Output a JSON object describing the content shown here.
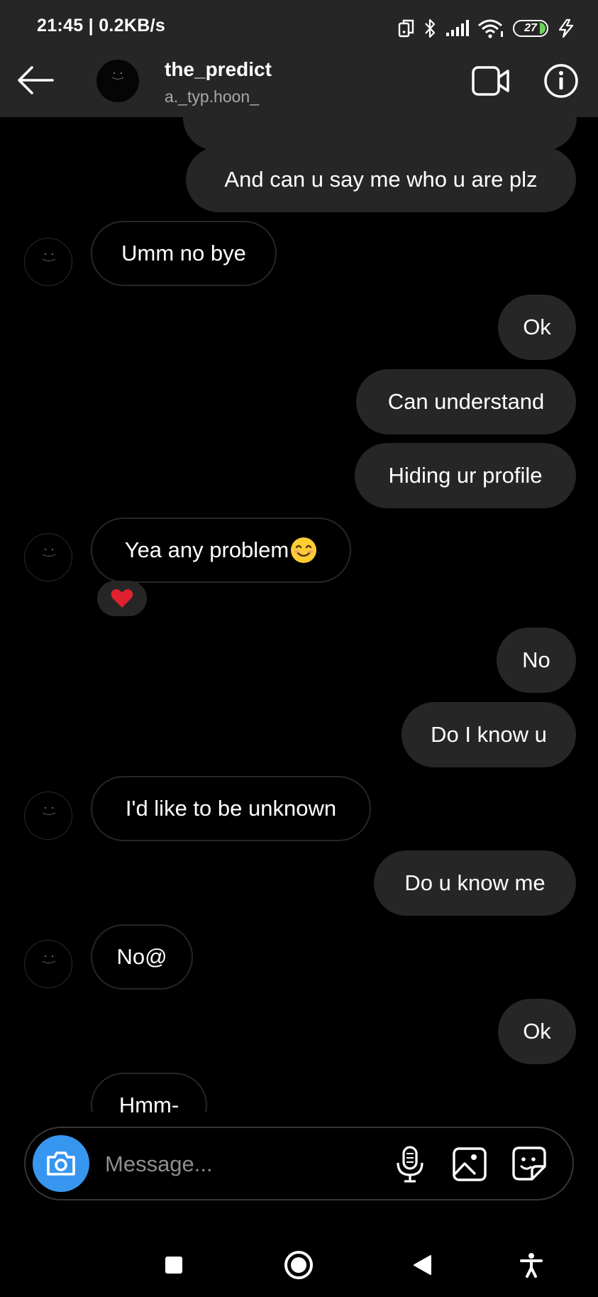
{
  "status_bar": {
    "time": "21:45 | 0.2KB/s",
    "battery": "27",
    "icons": [
      "dual-app-icon",
      "bluetooth-icon",
      "signal-icon",
      "wifi-icon",
      "battery-icon",
      "charging-icon"
    ]
  },
  "header": {
    "name": "the_predict",
    "handle": "a._typ.hoon_",
    "actions": [
      "back-arrow-icon",
      "video-call-icon",
      "info-icon"
    ]
  },
  "messages": [
    {
      "from": "me",
      "text": ""
    },
    {
      "from": "me",
      "text": "And can u say me who u are plz"
    },
    {
      "from": "them",
      "text": "Umm no bye"
    },
    {
      "from": "me",
      "text": "Ok"
    },
    {
      "from": "me",
      "text": "Can understand"
    },
    {
      "from": "me",
      "text": "Hiding ur profile"
    },
    {
      "from": "them",
      "text": "Yea any problem",
      "emoji": "smiling-face-emoji",
      "reaction": "red-heart-emoji"
    },
    {
      "from": "me",
      "text": "No"
    },
    {
      "from": "me",
      "text": "Do I know u"
    },
    {
      "from": "them",
      "text": "I'd like to be unknown"
    },
    {
      "from": "me",
      "text": "Do u know me"
    },
    {
      "from": "them",
      "text": "No@"
    },
    {
      "from": "me",
      "text": "Ok"
    },
    {
      "from": "them",
      "text": "Hmm-"
    }
  ],
  "composer": {
    "placeholder": "Message...",
    "icons": [
      "camera-icon",
      "microphone-icon",
      "gallery-icon",
      "sticker-icon"
    ]
  },
  "nav_bar": {
    "icons": [
      "recents-square-icon",
      "home-circle-icon",
      "back-triangle-icon",
      "accessibility-icon"
    ]
  },
  "colors": {
    "background": "#000000",
    "header": "#262626",
    "sent_bubble": "#262626",
    "received_border": "#262626",
    "camera_button": "#3797f0",
    "placeholder": "#8e8e8e",
    "handle": "#a8a8a8"
  }
}
